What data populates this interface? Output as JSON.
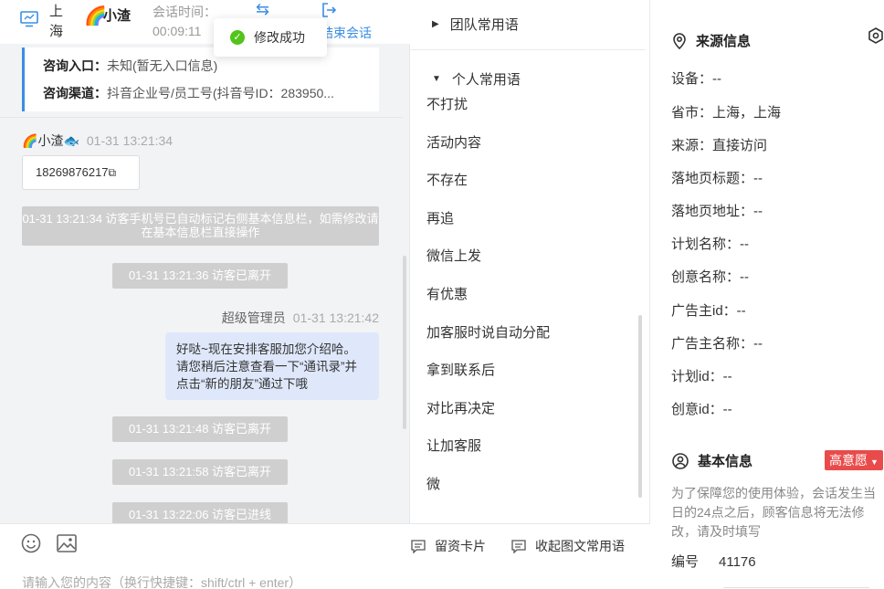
{
  "header": {
    "location": "上海",
    "visitor_name": "小渣",
    "session_time_label": "会话时间：",
    "session_time": "00:09:11",
    "end_session": "结束会话"
  },
  "toast": {
    "message": "修改成功"
  },
  "info_card": {
    "entry_label": "咨询入口：",
    "entry_value": "未知(暂无入口信息)",
    "channel_label": "咨询渠道：",
    "channel_value": "抖音企业号/员工号(抖音号ID：283950..."
  },
  "chat": {
    "visitor_label": "小渣",
    "visitor_time": "01-31 13:21:34",
    "phone": "18269876217",
    "system_notice": "01-31 13:21:34 访客手机号已自动标记右侧基本信息栏，如需修改请在基本信息栏直接操作",
    "events": [
      "01-31 13:21:36 访客已离开",
      "01-31 13:21:48 访客已离开",
      "01-31 13:21:58 访客已离开",
      "01-31 13:22:06 访客已进线"
    ],
    "agent_name": "超级管理员",
    "agent_time": "01-31 13:21:42",
    "agent_message": "好哒~现在安排客服加您介绍哈。请您稍后注意查看一下“通讯录”并点击“新的朋友”通过下哦"
  },
  "input": {
    "card_button": "留资卡片",
    "collapse_button": "收起图文常用语",
    "placeholder": "请输入您的内容（换行快捷键：shift/ctrl + enter）"
  },
  "phrases": {
    "team_group": "团队常用语",
    "personal_group": "个人常用语",
    "items": [
      "不打扰",
      "活动内容",
      "不存在",
      "再追",
      "微信上发",
      "有优惠",
      "加客服时说自动分配",
      "拿到联系后",
      "对比再决定",
      "让加客服",
      "微"
    ]
  },
  "source_info": {
    "title": "来源信息",
    "fields": [
      "设备：--",
      "省市：上海，上海",
      "来源：直接访问",
      "落地页标题：--",
      "落地页地址：--",
      "计划名称：--",
      "创意名称：--",
      "广告主id：--",
      "广告主名称：--",
      "计划id：--",
      "创意id：--"
    ]
  },
  "basic_info": {
    "title": "基本信息",
    "intent": "高意愿",
    "note": "为了保障您的使用体验，会话发生当日的24点之后，顾客信息将无法修改，请及时填写",
    "id_label": "编号",
    "id_value": "41176"
  },
  "colors": {
    "accent": "#3a8ee6",
    "intent": "#e94b4b",
    "bubble": "#dfe8fb",
    "success": "#52c41a"
  }
}
